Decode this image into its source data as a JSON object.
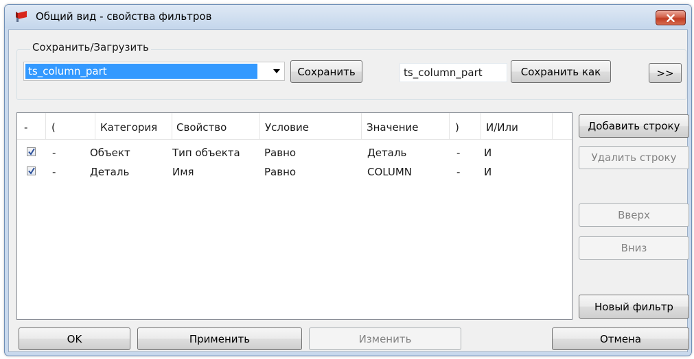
{
  "window": {
    "title": "Общий вид - свойства фильтров"
  },
  "save_load": {
    "legend": "Сохранить/Загрузить",
    "combo_value": "ts_column_part",
    "save_label": "Сохранить",
    "save_as_name": "ts_column_part",
    "save_as_label": "Сохранить как",
    "expand_label": ">>"
  },
  "grid": {
    "headers": [
      "-",
      "(",
      "Категория",
      "Свойство",
      "Условие",
      "Значение",
      ")",
      "И/Или"
    ],
    "rows": [
      {
        "checked": true,
        "open": "-",
        "category": "Объект",
        "property": "Тип объекта",
        "condition": "Равно",
        "value": "Деталь",
        "close": "-",
        "andor": "И"
      },
      {
        "checked": true,
        "open": "-",
        "category": "Деталь",
        "property": "Имя",
        "condition": "Равно",
        "value": "COLUMN",
        "close": "-",
        "andor": "И"
      }
    ]
  },
  "side_buttons": {
    "add_row": "Добавить строку",
    "delete_row": "Удалить строку",
    "up": "Вверх",
    "down": "Вниз",
    "new_filter": "Новый фильтр"
  },
  "bottom_buttons": {
    "ok": "OK",
    "apply": "Применить",
    "modify": "Изменить",
    "cancel": "Отмена"
  },
  "colors": {
    "selection": "#3399ff",
    "close_button": "#c03b22",
    "disabled_text": "#838383"
  },
  "icons": [
    "app-icon",
    "close-icon",
    "dropdown-arrow-icon",
    "checkbox-check-icon"
  ]
}
